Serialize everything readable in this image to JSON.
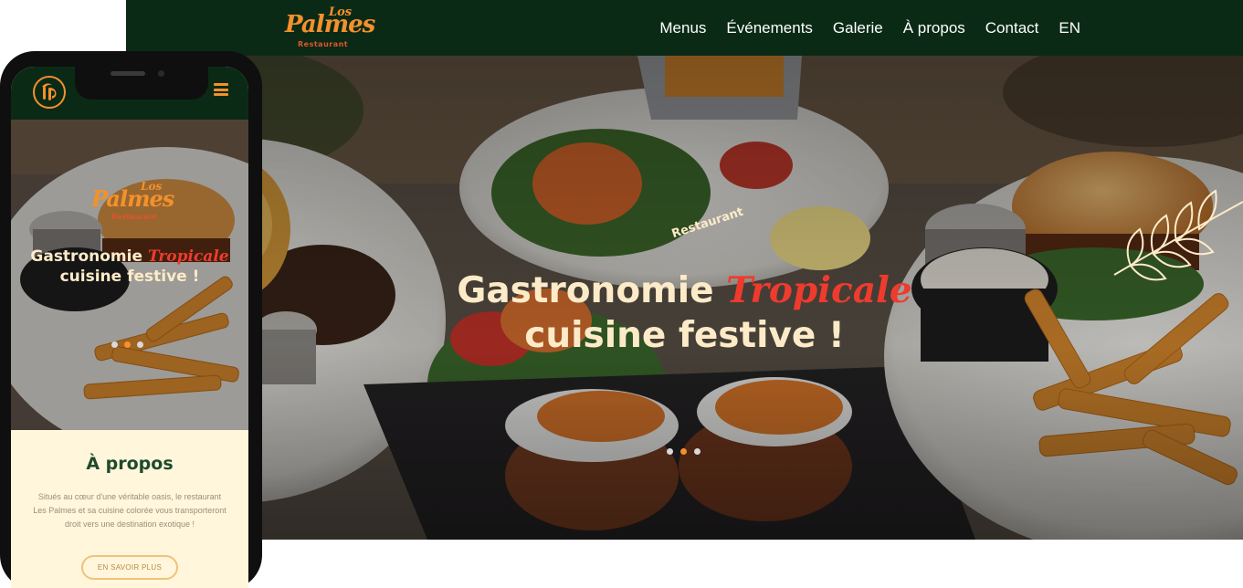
{
  "brand": {
    "los": "Los",
    "name": "Palmes",
    "tagline": "Restaurant",
    "badge_text": "Restaurant"
  },
  "nav": {
    "items": [
      {
        "label": "Menus"
      },
      {
        "label": "Événements"
      },
      {
        "label": "Galerie"
      },
      {
        "label": "À propos"
      },
      {
        "label": "Contact"
      },
      {
        "label": "EN"
      }
    ]
  },
  "hero": {
    "line1_prefix": "Gastronomie ",
    "line1_accent": "Tropicale",
    "line2": "cuisine festive !",
    "slides": 3,
    "active_slide": 2
  },
  "mobile": {
    "hero": {
      "line1_prefix": "Gastronomie ",
      "line1_accent": "Tropicale",
      "line2": "cuisine festive !"
    },
    "about": {
      "title": "À propos",
      "text_1": "Situés au cœur d'une véritable oasis, le restaurant",
      "text_2": "Les Palmes et sa cuisine colorée vous transporteront",
      "text_3": "droit vers une destination exotique !",
      "button": "EN SAVOIR PLUS"
    }
  },
  "colors": {
    "nav_bg": "#0b2a16",
    "brand_orange": "#f4912c",
    "accent_red": "#ef3b2d",
    "cream": "#fdebc8",
    "about_bg": "#fff6dc",
    "about_title": "#1f4a2c"
  },
  "icons": {
    "menu": "hamburger-icon",
    "logo": "palm-tree-icon",
    "decor": "leaf-branch-icon"
  }
}
